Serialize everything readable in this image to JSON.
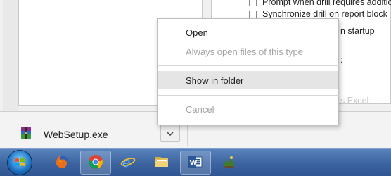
{
  "settings_panel": {
    "options": [
      {
        "label": "Prompt when drill requires additional",
        "checked": false
      },
      {
        "label": "Synchronize drill on report block",
        "checked": false
      }
    ],
    "fragment_startup": "n startup",
    "fragment_colon": ":",
    "fragment_excel": "s Excel:"
  },
  "context_menu": {
    "items": [
      {
        "label": "Open",
        "enabled": true
      },
      {
        "label": "Always open files of this type",
        "enabled": false
      },
      {
        "label": "Show in folder",
        "enabled": true,
        "highlighted": true
      },
      {
        "label": "Cancel",
        "enabled": false
      }
    ]
  },
  "download_shelf": {
    "file_name": "WebSetup.exe",
    "menu_icon": "chevron-down-icon",
    "file_icon": "winrar-archive-icon"
  },
  "taskbar": {
    "items": [
      {
        "name": "start-button",
        "icon": "windows-orb-icon"
      },
      {
        "name": "firefox",
        "icon": "firefox-icon"
      },
      {
        "name": "chrome",
        "icon": "chrome-icon",
        "active": true
      },
      {
        "name": "internet-explorer",
        "icon": "ie-icon"
      },
      {
        "name": "file-explorer",
        "icon": "folder-icon"
      },
      {
        "name": "word",
        "icon": "word-icon",
        "active": true
      },
      {
        "name": "app",
        "icon": "app-icon"
      }
    ]
  },
  "colors": {
    "taskbar": "#3c64a0",
    "menu_highlight": "#e5e5e5",
    "disabled_text": "#a3a3a3"
  }
}
